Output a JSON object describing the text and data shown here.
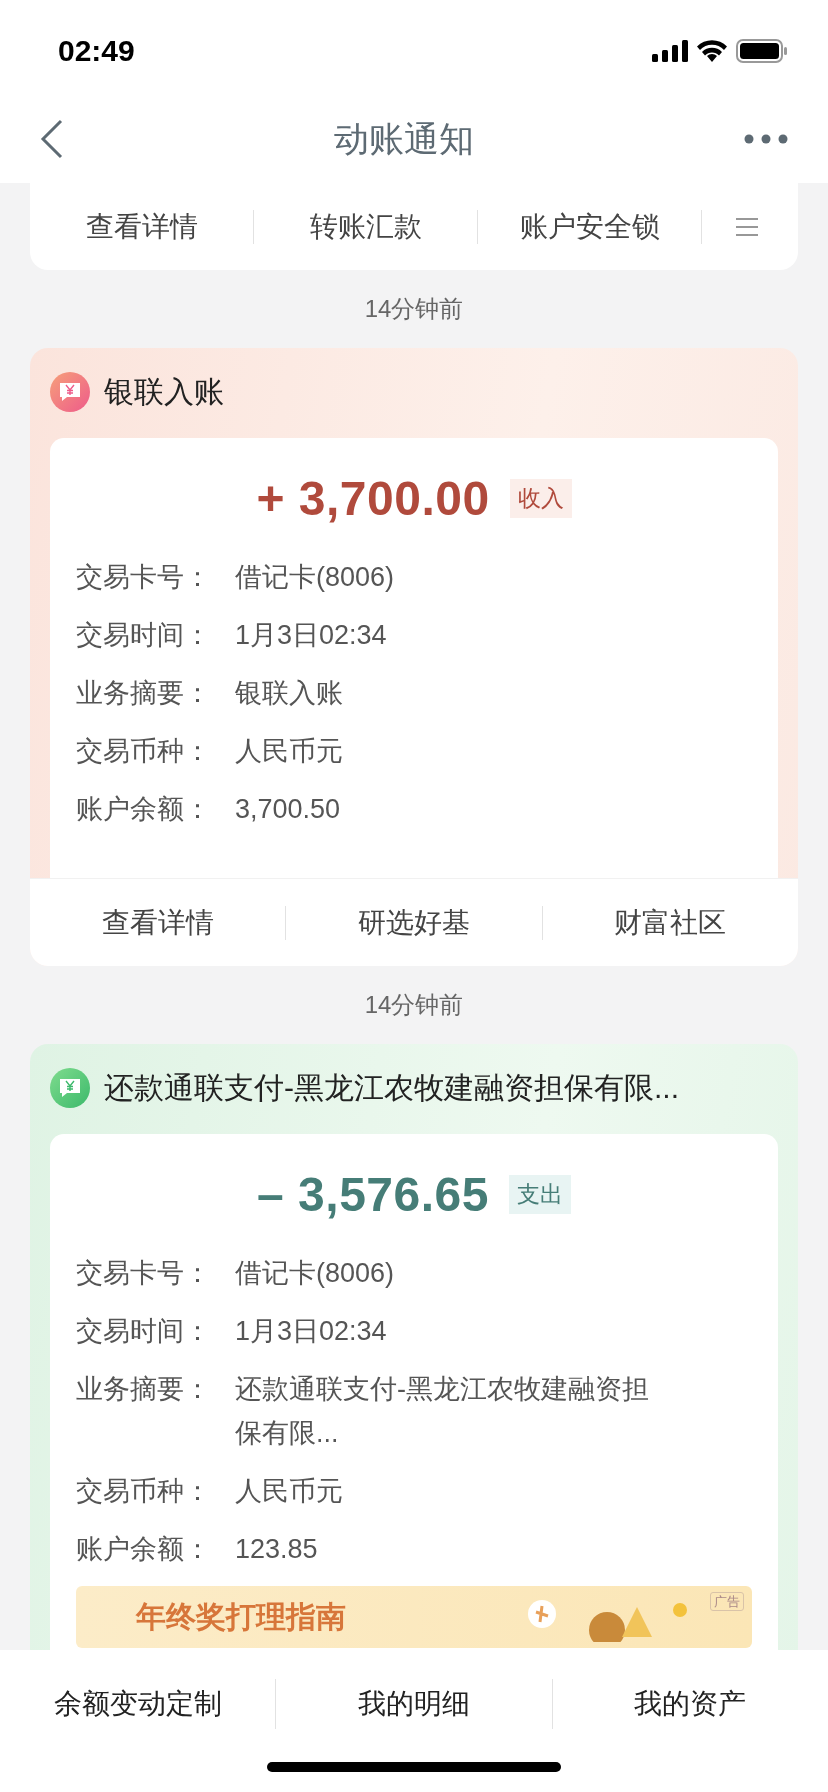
{
  "status_bar": {
    "time": "02:49"
  },
  "nav": {
    "title": "动账通知"
  },
  "quick_actions": [
    {
      "label": "查看详情"
    },
    {
      "label": "转账汇款"
    },
    {
      "label": "账户安全锁"
    }
  ],
  "messages": [
    {
      "time_ago": "14分钟前",
      "kind": "income",
      "title": "银联入账",
      "amount": "+ 3,700.00",
      "tag": "收入",
      "fields": [
        {
          "label": "交易卡号：",
          "value": "借记卡(8006)"
        },
        {
          "label": "交易时间：",
          "value": "1月3日02:34"
        },
        {
          "label": "业务摘要：",
          "value": "银联入账"
        },
        {
          "label": "交易币种：",
          "value": "人民币元"
        },
        {
          "label": "账户余额：",
          "value": "3,700.50"
        }
      ],
      "actions": [
        {
          "label": "查看详情"
        },
        {
          "label": "研选好基"
        },
        {
          "label": "财富社区"
        }
      ]
    },
    {
      "time_ago": "14分钟前",
      "kind": "expense",
      "title": "还款通联支付-黑龙江农牧建融资担保有限...",
      "amount": "– 3,576.65",
      "tag": "支出",
      "fields": [
        {
          "label": "交易卡号：",
          "value": "借记卡(8006)"
        },
        {
          "label": "交易时间：",
          "value": "1月3日02:34"
        },
        {
          "label": "业务摘要：",
          "value": "还款通联支付-黑龙江农牧建融资担保有限..."
        },
        {
          "label": "交易币种：",
          "value": "人民币元"
        },
        {
          "label": "账户余额：",
          "value": "123.85"
        }
      ],
      "ad": {
        "badge": "广告",
        "headline": "年终奖打理指南"
      }
    }
  ],
  "bottom_tabs": [
    {
      "label": "余额变动定制"
    },
    {
      "label": "我的明细"
    },
    {
      "label": "我的资产"
    }
  ]
}
